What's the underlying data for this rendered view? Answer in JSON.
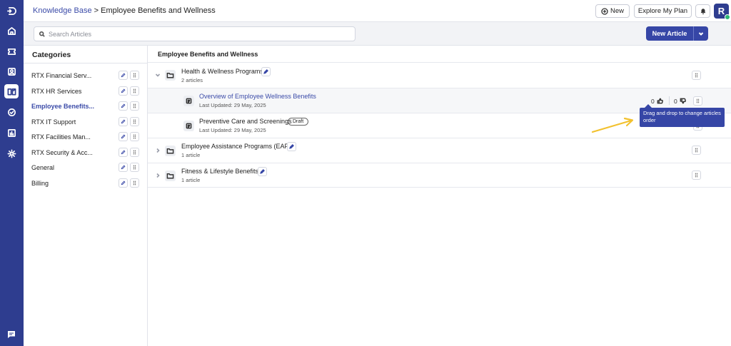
{
  "rail": {
    "items": [
      {
        "name": "logo-icon"
      },
      {
        "name": "home-icon"
      },
      {
        "name": "ticket-icon"
      },
      {
        "name": "contacts-icon"
      },
      {
        "name": "knowledge-base-icon",
        "active": true
      },
      {
        "name": "check-circle-icon"
      },
      {
        "name": "reports-icon"
      },
      {
        "name": "settings-icon"
      }
    ],
    "chat_icon": "chat-icon"
  },
  "header": {
    "breadcrumb_link": "Knowledge Base",
    "breadcrumb_separator": ">",
    "breadcrumb_current": "Employee Benefits and Wellness",
    "new_label": "New",
    "explore_label": "Explore My Plan",
    "avatar_letter": "R"
  },
  "toolbar": {
    "search_placeholder": "Search Articles",
    "new_article_label": "New Article"
  },
  "categories": {
    "title": "Categories",
    "items": [
      {
        "label": "RTX Financial Serv..."
      },
      {
        "label": "RTX HR Services"
      },
      {
        "label": "Employee Benefits...",
        "active": true
      },
      {
        "label": "RTX IT Support"
      },
      {
        "label": "RTX Facilities Man..."
      },
      {
        "label": "RTX Security & Acc..."
      },
      {
        "label": "General"
      },
      {
        "label": "Billing"
      }
    ]
  },
  "main": {
    "title": "Employee Benefits and Wellness",
    "folders": [
      {
        "title": "Health & Wellness Programs",
        "count": "2 articles",
        "expanded": true,
        "articles": [
          {
            "title": "Overview of Employee Wellness Benefits",
            "updated": "Last Updated: 29 May, 2025",
            "likes": "0",
            "dislikes": "0"
          },
          {
            "title": "Preventive Care and Screenings",
            "updated": "Last Updated: 29 May, 2025",
            "badge": "Draft"
          }
        ]
      },
      {
        "title": "Employee Assistance Programs (EAP)",
        "count": "1 article",
        "expanded": false
      },
      {
        "title": "Fitness & Lifestyle Benefits",
        "count": "1 article",
        "expanded": false
      }
    ],
    "tooltip": "Drag and drop to change articles order"
  },
  "colors": {
    "brand": "#2e3d8f",
    "primary_button": "#3646a6",
    "link": "#3b4ba8",
    "annotation_arrow": "#f2c12e",
    "online_status": "#2bb673"
  }
}
